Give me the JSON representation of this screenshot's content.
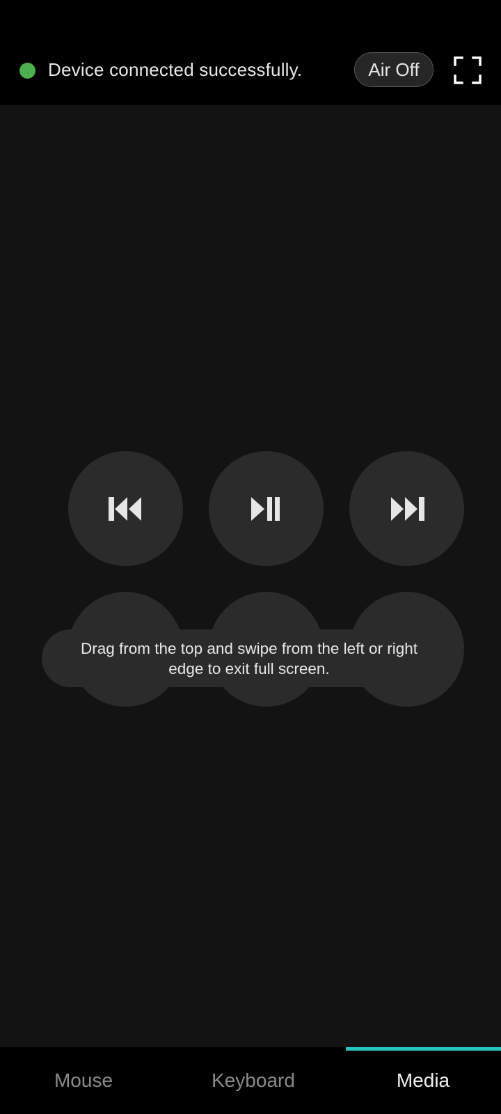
{
  "header": {
    "connection_status": "Device connected successfully.",
    "connection_color": "#4caf50",
    "air_button_label": "Air Off",
    "fullscreen_icon": "fullscreen-icon"
  },
  "media": {
    "row1": [
      {
        "name": "previous-track",
        "icon": "skip-previous-icon"
      },
      {
        "name": "play-pause",
        "icon": "play-pause-icon"
      },
      {
        "name": "next-track",
        "icon": "skip-next-icon"
      }
    ]
  },
  "toast": {
    "message": "Drag from the top and swipe from the left or right edge to exit full screen."
  },
  "tabs": [
    {
      "label": "Mouse",
      "selected": false
    },
    {
      "label": "Keyboard",
      "selected": false
    },
    {
      "label": "Media",
      "selected": true
    }
  ],
  "colors": {
    "accent": "#26c6c0",
    "tab_selected": "#f0f0f0",
    "tab_unselected": "#8a8a8a",
    "background": "#131313",
    "button": "#2b2b2b"
  }
}
